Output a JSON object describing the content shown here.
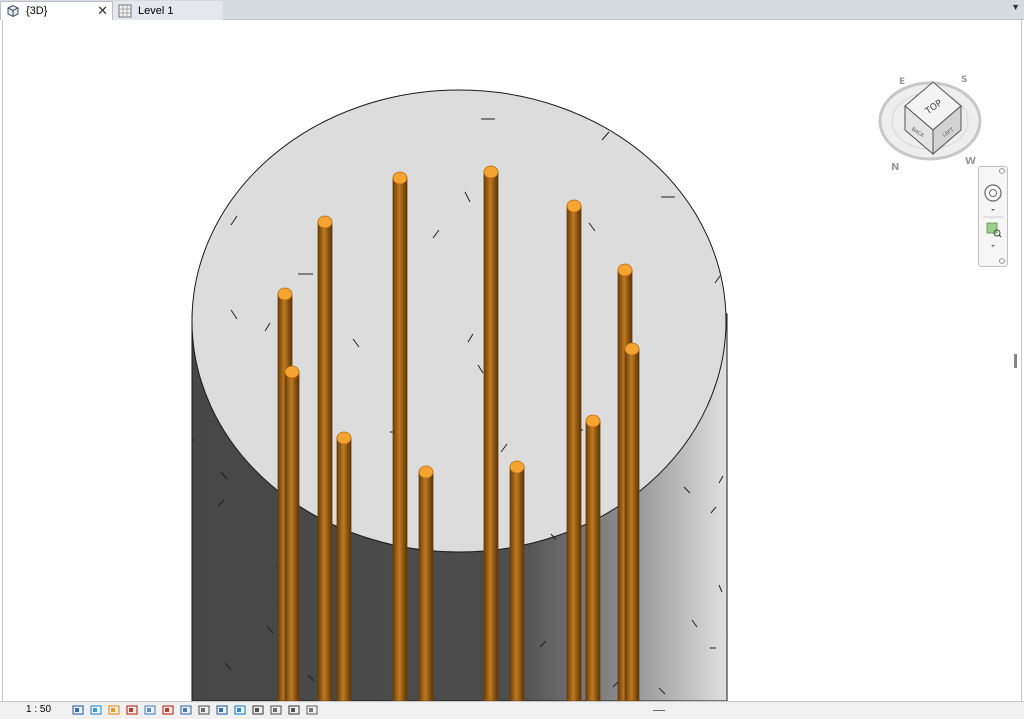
{
  "tabs": [
    {
      "label": "{3D}",
      "icon": "3d-view-icon",
      "active": true
    },
    {
      "label": "Level 1",
      "icon": "floor-plan-icon",
      "active": false
    }
  ],
  "tab_close_symbol": "✕",
  "tab_dropdown_symbol": "▼",
  "viewcube": {
    "face_top": "TOP",
    "face_back": "BACK",
    "face_left": "LEFT",
    "compass": [
      "S",
      "W",
      "N",
      "E"
    ]
  },
  "status_bar": {
    "scale": "1 : 50",
    "icons": [
      "detail-level-icon",
      "visual-style-icon",
      "sun-path-icon",
      "shadows-icon",
      "crop-view-icon",
      "show-crop-icon",
      "unlock-3d-icon",
      "temporary-hide-icon",
      "reveal-hidden-icon",
      "lock-view-icon",
      "analysis-icon",
      "highlight-displacement-icon",
      "worksharing-icon",
      "design-options-icon",
      "reveal-constraints-icon"
    ]
  },
  "colors": {
    "rebar": "#c07a1e",
    "rebar_dark": "#6a3e0c",
    "rebar_cap": "#f5a431",
    "concrete_top": "#dcdcdc",
    "concrete_side": "#4a4a4a"
  }
}
